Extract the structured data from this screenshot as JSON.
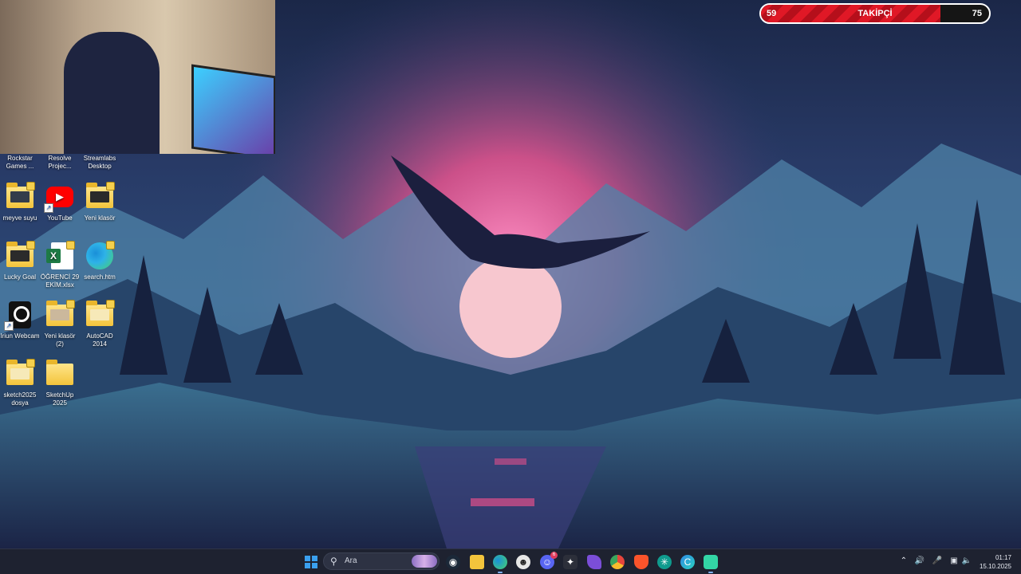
{
  "overlay": {
    "follower_goal": {
      "current": "59",
      "label": "TAKİPÇİ",
      "target": "75",
      "progress_fraction": 0.786
    }
  },
  "desktop": {
    "icons": [
      {
        "label": "Rockstar Games ...",
        "icon": "rockstar-icon"
      },
      {
        "label": "Resolve Projec...",
        "icon": "resolve-icon"
      },
      {
        "label": "Streamlabs Desktop",
        "icon": "streamlabs-icon"
      },
      {
        "label": "meyve suyu",
        "icon": "folder-icon"
      },
      {
        "label": "YouTube",
        "icon": "youtube-icon"
      },
      {
        "label": "Yeni klasör",
        "icon": "folder-icon"
      },
      {
        "label": "Lucky Goal",
        "icon": "folder-icon"
      },
      {
        "label": "ÖĞRENCİ 29 EKİM.xlsx",
        "icon": "excel-icon"
      },
      {
        "label": "search.htm",
        "icon": "edge-icon"
      },
      {
        "label": "Iriun Webcam",
        "icon": "iriun-icon"
      },
      {
        "label": "Yeni klasör (2)",
        "icon": "folder-icon"
      },
      {
        "label": "AutoCAD 2014",
        "icon": "folder-icon"
      },
      {
        "label": "sketch2025 dosya",
        "icon": "folder-icon"
      },
      {
        "label": "SketchUp 2025",
        "icon": "folder-icon"
      }
    ]
  },
  "taskbar": {
    "search_placeholder": "Ara",
    "apps": [
      {
        "name": "windows-start-icon",
        "color": "#3aa0f0"
      },
      {
        "name": "steam-icon",
        "color": "#1b2838"
      },
      {
        "name": "file-explorer-icon",
        "color": "#f3c43c"
      },
      {
        "name": "edge-icon",
        "color": "#1aa3d9"
      },
      {
        "name": "profile-app-icon",
        "color": "#e7e7e7"
      },
      {
        "name": "discord-icon",
        "color": "#5865f2",
        "badge": "6"
      },
      {
        "name": "davinci-resolve-icon",
        "color": "#2c2f3a"
      },
      {
        "name": "obsidian-icon",
        "color": "#7b4ed8"
      },
      {
        "name": "chrome-icon",
        "color": "#e8453c"
      },
      {
        "name": "brave-icon",
        "color": "#fb542b"
      },
      {
        "name": "circle-app-icon",
        "color": "#0f9b8e"
      },
      {
        "name": "copilot-icon",
        "color": "#2f8be6"
      },
      {
        "name": "capcut-icon",
        "color": "#33d6a6"
      }
    ],
    "clock": {
      "time": "01:17",
      "date": "15.10.2025"
    }
  }
}
